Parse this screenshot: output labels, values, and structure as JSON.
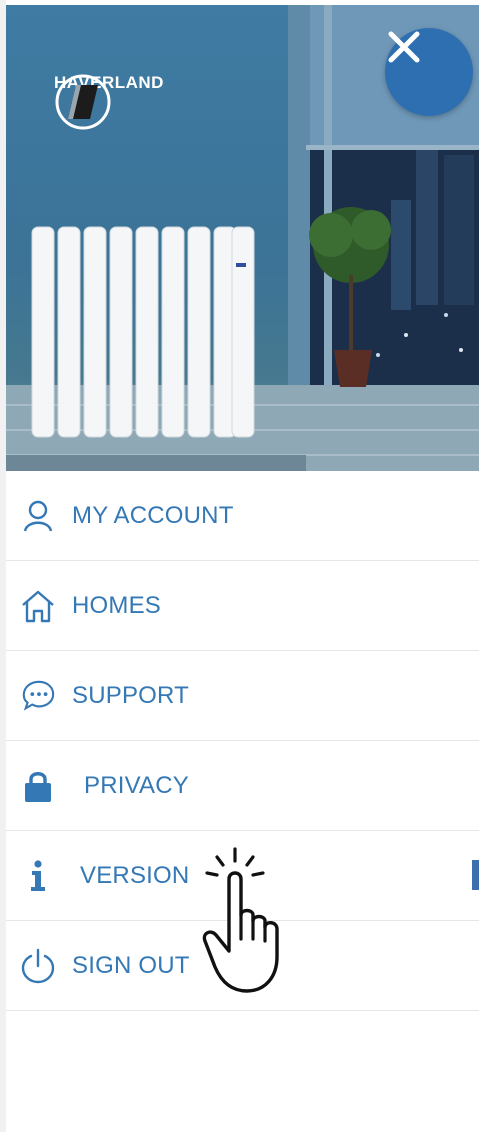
{
  "brand": {
    "name": "HAVERLAND"
  },
  "menu": {
    "items": [
      {
        "label": "MY ACCOUNT",
        "icon": "user-icon"
      },
      {
        "label": "HOMES",
        "icon": "home-icon"
      },
      {
        "label": "SUPPORT",
        "icon": "chat-icon"
      },
      {
        "label": "PRIVACY",
        "icon": "lock-icon"
      },
      {
        "label": "VERSION",
        "icon": "info-icon"
      },
      {
        "label": "SIGN OUT",
        "icon": "power-icon"
      }
    ]
  },
  "colors": {
    "accent": "#3478b5",
    "close_button": "#2e6fb2",
    "hero": "#3f7ba3"
  },
  "overlay": {
    "icon": "tap-hand-icon"
  }
}
